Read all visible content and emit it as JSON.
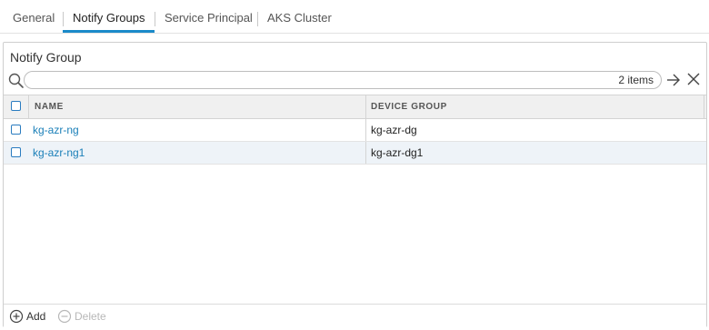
{
  "tabs": [
    {
      "label": "General",
      "active": false
    },
    {
      "label": "Notify Groups",
      "active": true
    },
    {
      "label": "Service Principal",
      "active": false
    },
    {
      "label": "AKS Cluster",
      "active": false
    }
  ],
  "panel": {
    "title": "Notify Group",
    "search": {
      "value": "",
      "placeholder": "",
      "items_count": "2 items"
    },
    "columns": {
      "name": "NAME",
      "device_group": "DEVICE GROUP"
    },
    "rows": [
      {
        "name": "kg-azr-ng",
        "device_group": "kg-azr-dg"
      },
      {
        "name": "kg-azr-ng1",
        "device_group": "kg-azr-dg1"
      }
    ],
    "footer": {
      "add_label": "Add",
      "delete_label": "Delete"
    }
  },
  "colors": {
    "accent": "#1a8ac9",
    "link": "#1a7fb8",
    "row_alt": "#eef3f8",
    "header_bg": "#f0f0f0",
    "disabled": "#b8b8b8"
  },
  "icons": {
    "search": "search-icon",
    "go": "arrow-right-icon",
    "clear": "close-icon",
    "add": "plus-circle-icon",
    "delete": "minus-circle-icon"
  }
}
